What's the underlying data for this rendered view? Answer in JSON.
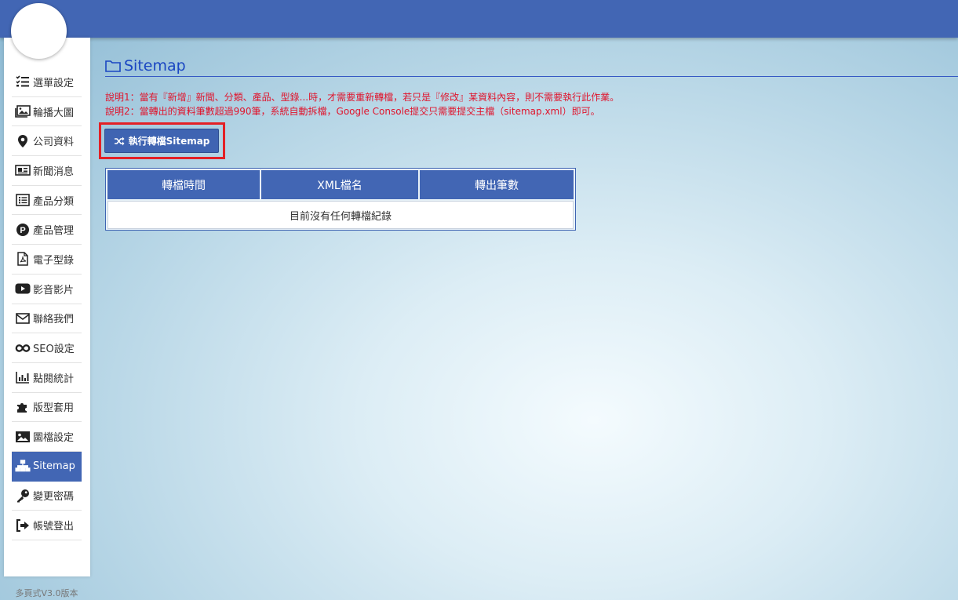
{
  "sidebar": {
    "items": [
      {
        "label": "選單設定",
        "icon": "list-check-icon"
      },
      {
        "label": "輪播大圖",
        "icon": "images-icon"
      },
      {
        "label": "公司資料",
        "icon": "map-marker-icon"
      },
      {
        "label": "新聞消息",
        "icon": "newspaper-icon"
      },
      {
        "label": "產品分類",
        "icon": "list-alt-icon"
      },
      {
        "label": "產品管理",
        "icon": "product-p-icon"
      },
      {
        "label": "電子型錄",
        "icon": "file-pdf-icon"
      },
      {
        "label": "影音影片",
        "icon": "youtube-icon"
      },
      {
        "label": "聯絡我們",
        "icon": "envelope-icon"
      },
      {
        "label": "SEO設定",
        "icon": "infinity-icon"
      },
      {
        "label": "點閱統計",
        "icon": "bar-chart-icon"
      },
      {
        "label": "版型套用",
        "icon": "puzzle-icon"
      },
      {
        "label": "圖檔設定",
        "icon": "image-icon"
      },
      {
        "label": "Sitemap",
        "icon": "sitemap-icon",
        "active": true
      },
      {
        "label": "變更密碼",
        "icon": "key-icon"
      },
      {
        "label": "帳號登出",
        "icon": "sign-out-icon"
      }
    ],
    "version": "多頁式V3.0版本"
  },
  "page": {
    "title": "Sitemap",
    "title_icon": "folder-icon",
    "note1": "說明1：當有『新增』新聞、分類、產品、型錄...時，才需要重新轉檔，若只是『修改』某資料內容，則不需要執行此作業。",
    "note2": "說明2：當轉出的資料筆數超過990筆，系統自動拆檔，Google Console提交只需要提交主檔（sitemap.xml）即可。"
  },
  "action": {
    "run_label": "執行轉檔Sitemap",
    "run_icon": "random-icon"
  },
  "table": {
    "headers": [
      "轉檔時間",
      "XML檔名",
      "轉出筆數"
    ],
    "empty_message": "目前沒有任何轉檔紀錄"
  },
  "colors": {
    "topbar": "#4266b4",
    "accent": "#4266b4",
    "note_text": "#e0142c",
    "highlight_border": "#e32025",
    "title_text": "#1a46c2"
  }
}
